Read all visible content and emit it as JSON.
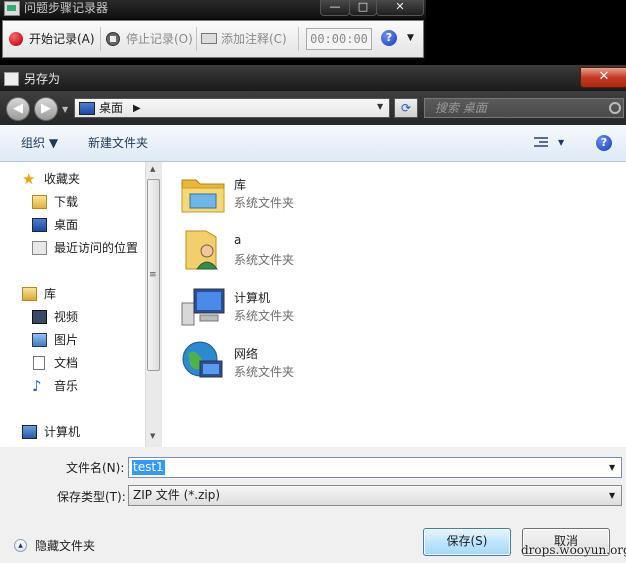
{
  "psr": {
    "title": "问题步骤记录器",
    "controls": {
      "minimize": "—",
      "maximize": "□",
      "close": "✕"
    },
    "start_label": "开始记录(A)",
    "stop_label": "停止记录(O)",
    "comment_label": "添加注释(C)",
    "timer": "00:00:00",
    "help": "?",
    "menu_arrow": "▼",
    "record_color": "#d21f2b"
  },
  "dialog": {
    "title": "另存为",
    "close": "✕",
    "nav": {
      "back": "◀",
      "forward": "▶",
      "history": "▼"
    },
    "address": {
      "location": "桌面",
      "chevron": "▶",
      "dropdown": "▼"
    },
    "refresh": "⟳",
    "search_placeholder": "搜索 桌面",
    "toolbar": {
      "organize": "组织 ▼",
      "new_folder": "新建文件夹",
      "view_arrow": "▼",
      "help": "?"
    },
    "sidebar": {
      "favorites": {
        "label": "收藏夹",
        "icon": "star-icon"
      },
      "favorite_items": [
        {
          "label": "下载",
          "icon": "downloads-folder-icon"
        },
        {
          "label": "桌面",
          "icon": "desktop-icon"
        },
        {
          "label": "最近访问的位置",
          "icon": "recent-places-icon"
        }
      ],
      "libraries": {
        "label": "库",
        "icon": "libraries-icon"
      },
      "library_items": [
        {
          "label": "视频",
          "icon": "videos-icon"
        },
        {
          "label": "图片",
          "icon": "pictures-icon"
        },
        {
          "label": "文档",
          "icon": "documents-icon"
        },
        {
          "label": "音乐",
          "icon": "music-icon"
        }
      ],
      "computer": {
        "label": "计算机",
        "icon": "computer-icon"
      },
      "scrollbar": {
        "up": "▲",
        "down": "▼",
        "grip": "≡"
      }
    },
    "items": [
      {
        "name": "库",
        "type": "系统文件夹",
        "icon": "library-folder-icon"
      },
      {
        "name": "a",
        "type": "系统文件夹",
        "icon": "user-folder-icon"
      },
      {
        "name": "计算机",
        "type": "系统文件夹",
        "icon": "computer-icon"
      },
      {
        "name": "网络",
        "type": "系统文件夹",
        "icon": "network-icon"
      }
    ],
    "filename": {
      "label": "文件名(N):",
      "value": "test1",
      "dropdown": "▼"
    },
    "filetype": {
      "label": "保存类型(T):",
      "value": "ZIP 文件 (*.zip)",
      "dropdown": "▼"
    },
    "hide_folders": {
      "label": "隐藏文件夹",
      "glyph": "▲"
    },
    "save_button": "保存(S)",
    "cancel_button": "取消"
  },
  "watermark": "drops.wooyun.org"
}
